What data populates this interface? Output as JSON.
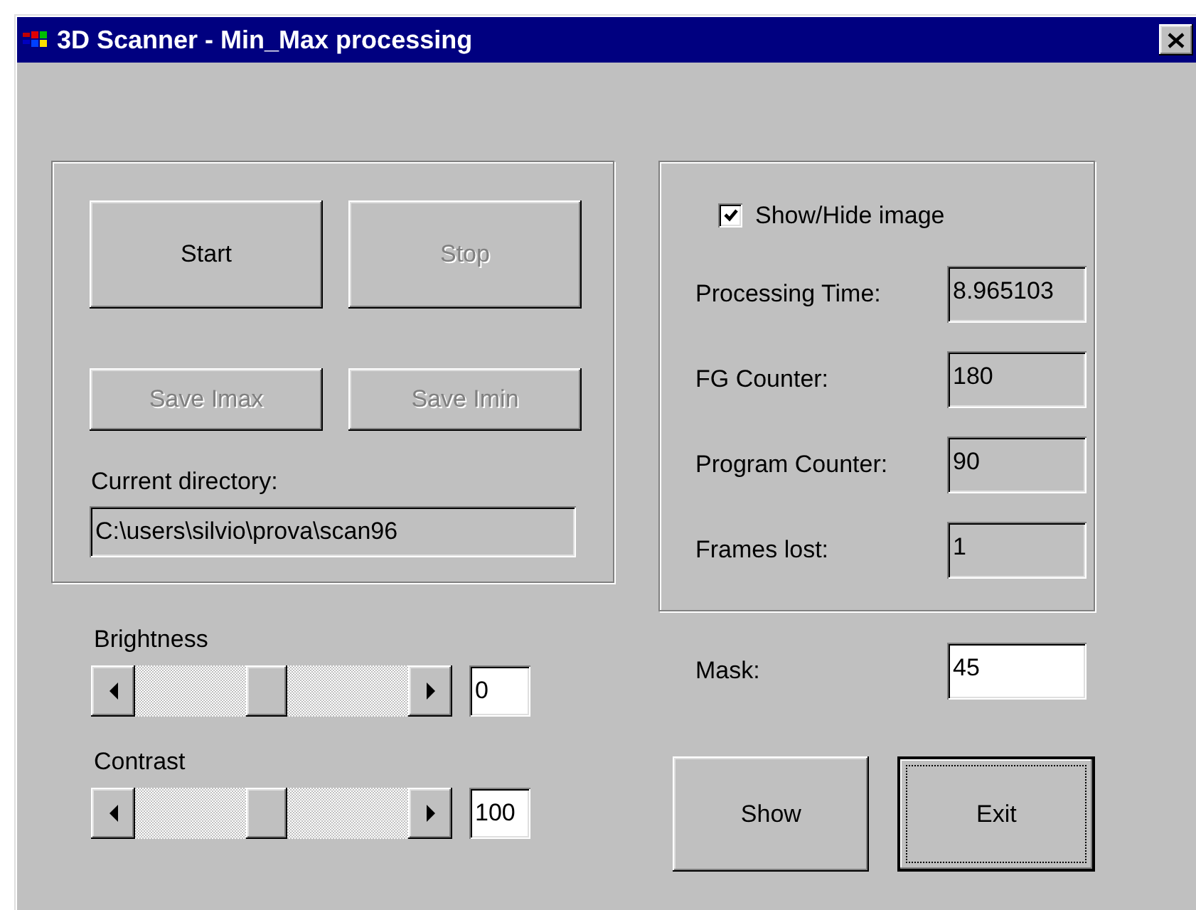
{
  "window": {
    "title": "3D Scanner - Min_Max processing"
  },
  "buttons": [
    {
      "label": "Start",
      "disabled": false
    },
    {
      "label": "Stop",
      "disabled": true
    }
  ],
  "save_buttons": [
    {
      "label": "Save Imax",
      "disabled": true
    },
    {
      "label": "Save Imin",
      "disabled": true
    }
  ],
  "current_directory": {
    "label": "Current directory:",
    "value": "C:\\users\\silvio\\prova\\scan96"
  },
  "show_hide": {
    "label": "Show/Hide image",
    "checked": true
  },
  "readouts": [
    {
      "label": "Processing Time:",
      "value": "8.965103"
    },
    {
      "label": "FG Counter:",
      "value": "180"
    },
    {
      "label": "Program Counter:",
      "value": "90"
    },
    {
      "label": "Frames lost:",
      "value": "1"
    }
  ],
  "sliders": [
    {
      "label": "Brightness",
      "level": 0.48,
      "value": "0"
    },
    {
      "label": "Contrast",
      "level": 0.48,
      "value": "100"
    }
  ],
  "mask": {
    "label": "Mask:",
    "value": "45"
  },
  "actions": [
    {
      "label": "Show",
      "focused": false
    },
    {
      "label": "Exit",
      "focused": true
    }
  ]
}
